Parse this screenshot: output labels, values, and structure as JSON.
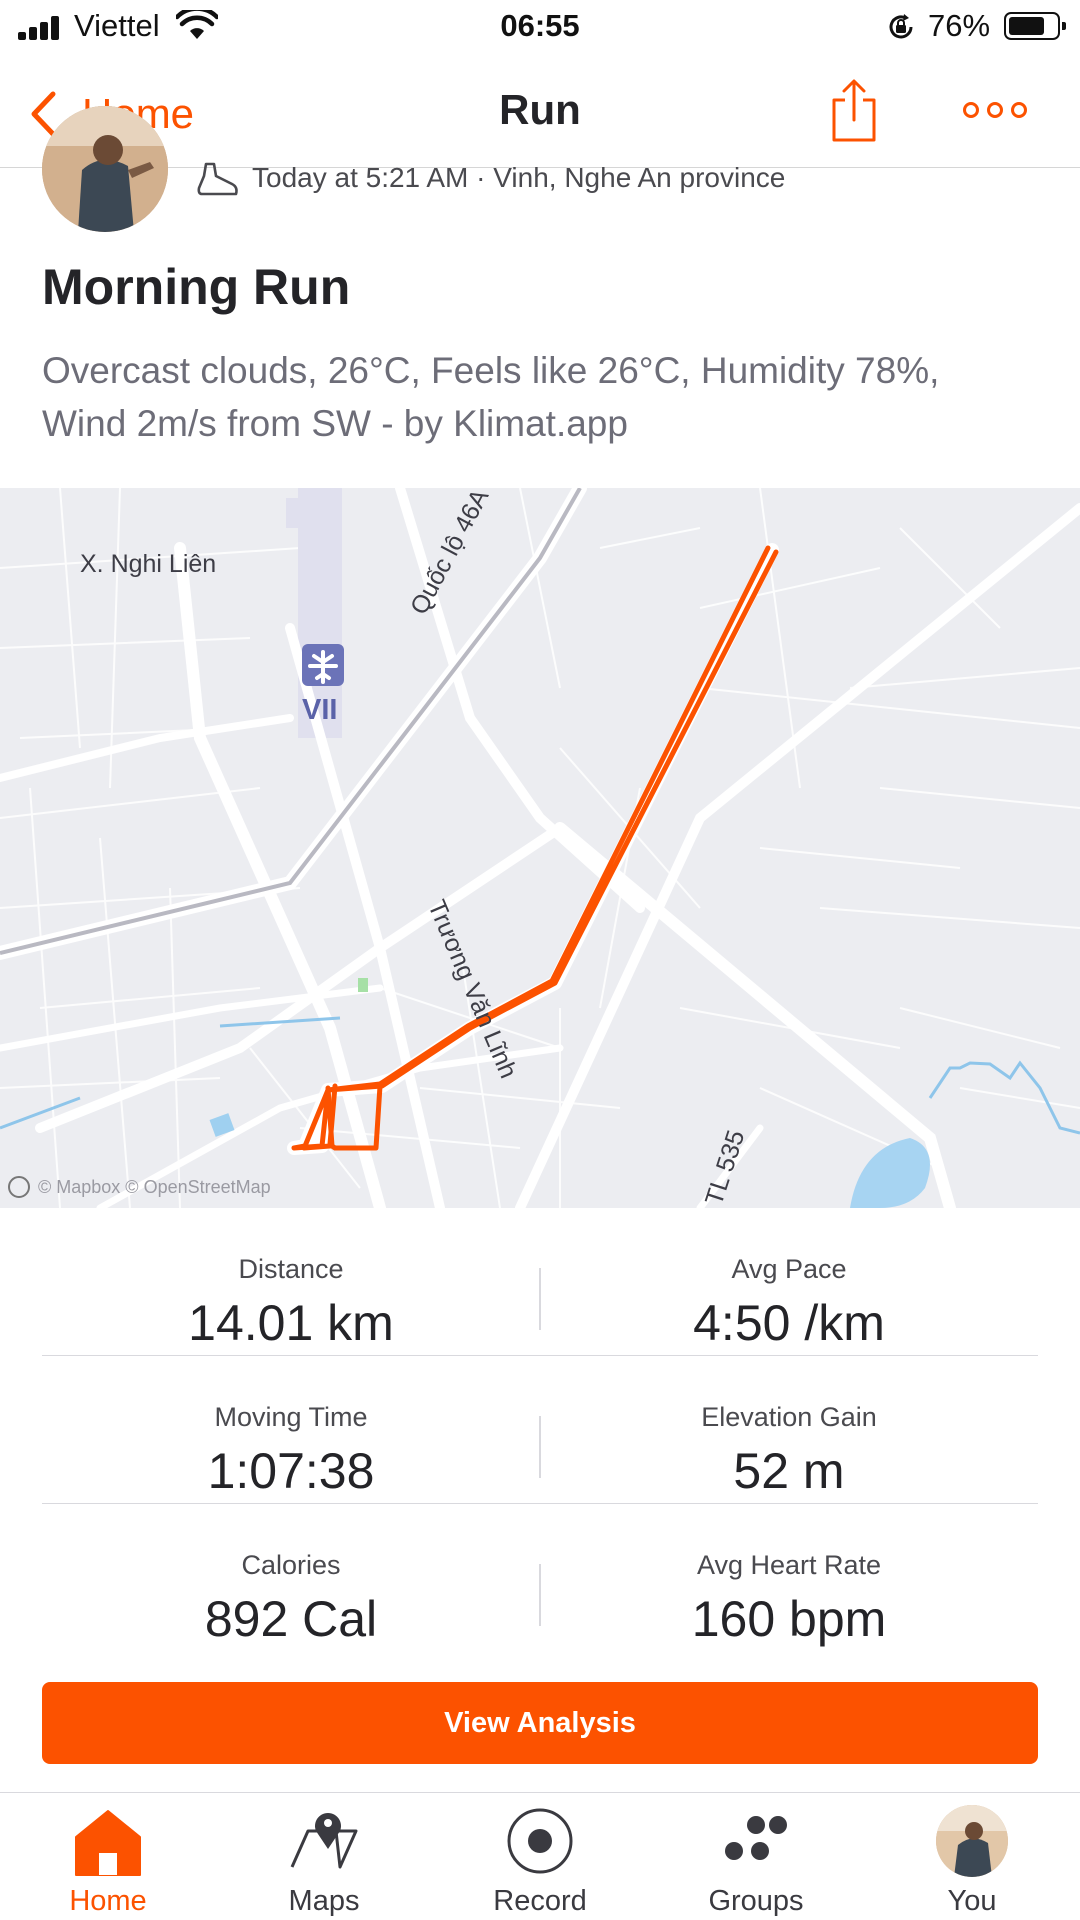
{
  "status_bar": {
    "carrier": "Viettel",
    "time": "06:55",
    "battery_percent": "76%",
    "battery_level": 0.76
  },
  "nav": {
    "back_label": "Home",
    "title": "Run",
    "share_icon": "share-icon",
    "more_icon": "more-icon"
  },
  "activity": {
    "meta": "Today at 5:21 AM · Vinh, Nghe An province",
    "title": "Morning Run",
    "description": "Overcast clouds, 26°C, Feels like 26°C, Humidity 78%, Wind 2m/s from SW - by Klimat.app"
  },
  "map": {
    "labels": {
      "village": "X. Nghi Liên",
      "highway": "Quốc lộ 46A",
      "airport_code": "VII",
      "street": "Trương Văn Lĩnh",
      "provincial_road": "TL 535"
    },
    "attribution": "© Mapbox © OpenStreetMap",
    "route_color": "#fc5200"
  },
  "stats": [
    [
      {
        "label": "Distance",
        "value": "14.01 km"
      },
      {
        "label": "Avg Pace",
        "value": "4:50 /km"
      }
    ],
    [
      {
        "label": "Moving Time",
        "value": "1:07:38"
      },
      {
        "label": "Elevation Gain",
        "value": "52 m"
      }
    ],
    [
      {
        "label": "Calories",
        "value": "892 Cal"
      },
      {
        "label": "Avg Heart Rate",
        "value": "160 bpm"
      }
    ]
  ],
  "actions": {
    "view_analysis": "View Analysis"
  },
  "tabs": [
    {
      "label": "Home",
      "icon": "home-icon",
      "active": true
    },
    {
      "label": "Maps",
      "icon": "maps-icon",
      "active": false
    },
    {
      "label": "Record",
      "icon": "record-icon",
      "active": false
    },
    {
      "label": "Groups",
      "icon": "groups-icon",
      "active": false
    },
    {
      "label": "You",
      "icon": "avatar",
      "active": false
    }
  ],
  "colors": {
    "accent": "#fc5200",
    "text_primary": "#242428",
    "text_secondary": "#6d6d78"
  }
}
